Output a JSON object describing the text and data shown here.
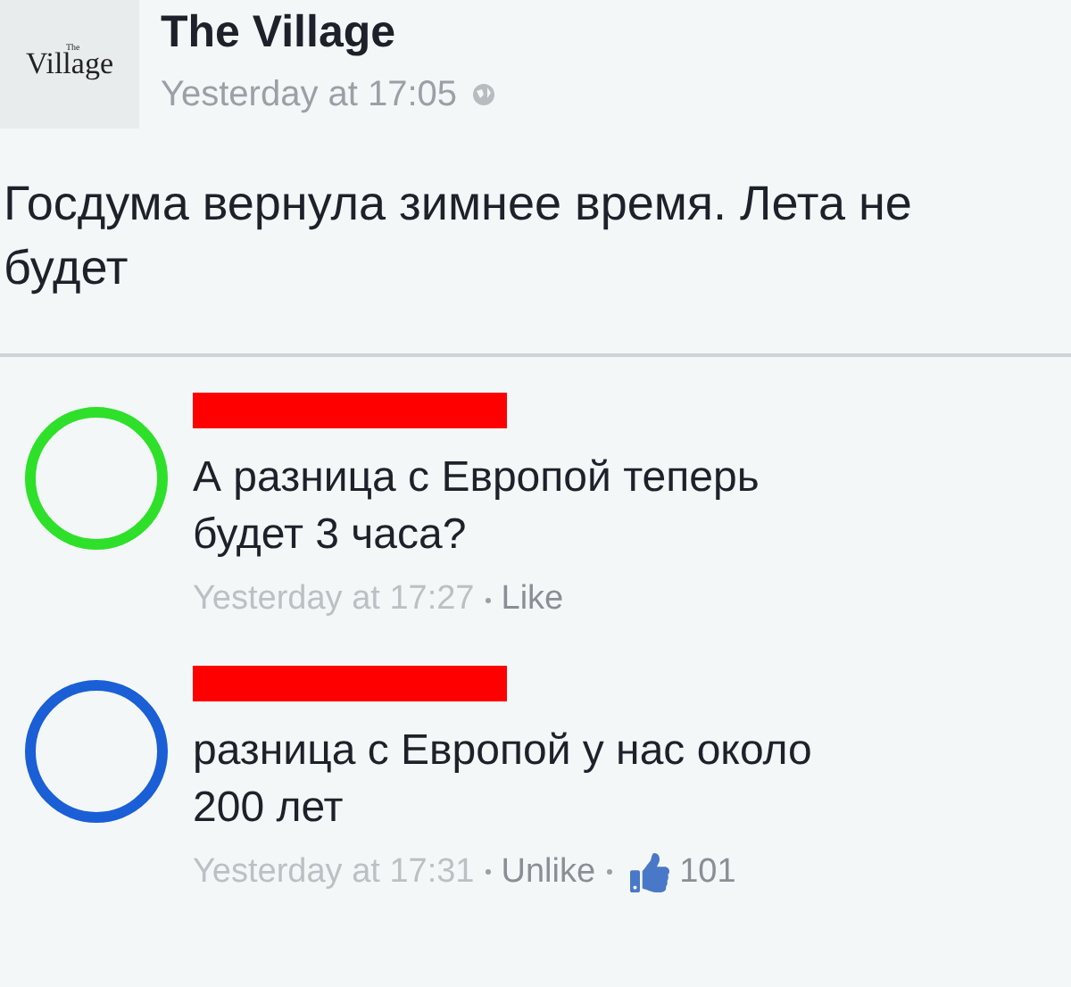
{
  "post": {
    "logo": "Village",
    "logo_small": "The",
    "author": "The Village",
    "time": "Yesterday at 17:05",
    "text": "Госдума вернула зимнее время. Лета не будет"
  },
  "comments": [
    {
      "color": "#2ee02a",
      "text": "А разница с Европой теперь будет 3 часа?",
      "time": "Yesterday at 17:27",
      "action": "Like"
    },
    {
      "color": "#1a5fd6",
      "text": "разница с Европой у нас около 200 лет",
      "time": "Yesterday at 17:31",
      "action": "Unlike",
      "likes": "101"
    }
  ]
}
